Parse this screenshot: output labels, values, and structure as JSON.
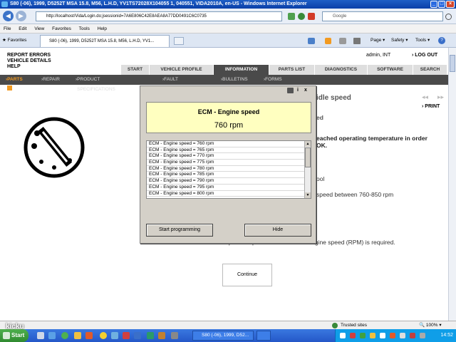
{
  "window": {
    "title": "S80 (-06), 1999, D5252T MSA 15.8, M56, L.H.D, YV1TS72028X104055 1, 040551, VIDA2010A, en-US - Windows Internet Explorer",
    "min": "_",
    "max": "□",
    "close": "×"
  },
  "addressbar": {
    "url": "http://localhost/Vida/Login.do;jsessionid=7A6E806C42E8AEA8A77DD0491C6C0735",
    "search_placeholder": "Google",
    "back": "◀",
    "forward": "▶"
  },
  "menu": {
    "items": [
      "File",
      "Edit",
      "View",
      "Favorites",
      "Tools",
      "Help"
    ]
  },
  "favbar": {
    "favorites": "Favorites",
    "tab_title": "S80 (-06), 1999, D5252T MSA 15.8, M56, L.H.D, YV1...",
    "page": "Page ▾",
    "safety": "Safety ▾",
    "tools": "Tools ▾",
    "help": "?"
  },
  "vida": {
    "report_errors": "REPORT ERRORS",
    "vehicle_details": "VEHICLE DETAILS",
    "help": "HELP",
    "user": "admin, INT",
    "logout": "LOG OUT",
    "tabs": [
      "START",
      "VEHICLE PROFILE",
      "INFORMATION",
      "PARTS LIST",
      "DIAGNOSTICS",
      "SOFTWARE",
      "SEARCH"
    ],
    "subnav": [
      "PARTS",
      "REPAIR",
      "PRODUCT SPECIFICATIONS",
      "FAULT TRACING",
      "BULLETINS",
      "FORMS"
    ],
    "print": "PRINT"
  },
  "content": {
    "heading_fragment": "idle speed",
    "line_ed": "ed",
    "warning_line1": "eached operating temperature in order",
    "warning_line2": "OK.",
    "line_ool": "ool",
    "speed_range": "speed between 760-850 rpm",
    "repeat": "Repeat the procedure if another engine speed (RPM) is required.",
    "continue": "Continue"
  },
  "dialog": {
    "icons": [
      "i",
      "x"
    ],
    "title": "ECM - Engine speed",
    "value": "760 rpm",
    "list": [
      "ECM - Engine speed = 760 rpm",
      "ECM - Engine speed = 765 rpm",
      "ECM - Engine speed = 770 rpm",
      "ECM - Engine speed = 775 rpm",
      "ECM - Engine speed = 780 rpm",
      "ECM - Engine speed = 785 rpm",
      "ECM - Engine speed = 790 rpm",
      "ECM - Engine speed = 795 rpm",
      "ECM - Engine speed = 800 rpm"
    ],
    "start_btn": "Start programming",
    "hide_btn": "Hide"
  },
  "status": {
    "zone": "Trusted sites",
    "zoom": "100%"
  },
  "taskbar": {
    "start": "Start",
    "task_ie": "S80 (-06), 1999, D52...",
    "time": "14:52"
  },
  "watermark": "kicku",
  "colors": {
    "titlebar": "#0a3fa8",
    "active_tab": "#4a4a4a",
    "subnav_selected": "#f29a21",
    "dialog_header": "#ffffc0"
  }
}
